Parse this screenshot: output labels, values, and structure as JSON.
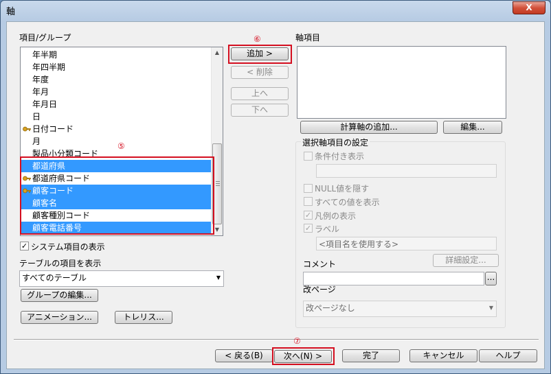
{
  "window": {
    "title": "軸",
    "close_label": "X"
  },
  "left": {
    "items_label": "項目/グループ",
    "list_items": [
      {
        "label": "年半期",
        "key": false,
        "selected": false
      },
      {
        "label": "年四半期",
        "key": false,
        "selected": false
      },
      {
        "label": "年度",
        "key": false,
        "selected": false
      },
      {
        "label": "年月",
        "key": false,
        "selected": false
      },
      {
        "label": "年月日",
        "key": false,
        "selected": false
      },
      {
        "label": "日",
        "key": false,
        "selected": false
      },
      {
        "label": "日付コード",
        "key": true,
        "selected": false
      },
      {
        "label": "月",
        "key": false,
        "selected": false
      },
      {
        "label": "製品小分類コード",
        "key": false,
        "selected": false
      },
      {
        "label": "都道府県",
        "key": false,
        "selected": true
      },
      {
        "label": "都道府県コード",
        "key": true,
        "selected": false
      },
      {
        "label": "顧客コード",
        "key": true,
        "selected": true
      },
      {
        "label": "顧客名",
        "key": false,
        "selected": true
      },
      {
        "label": "顧客種別コード",
        "key": false,
        "selected": false
      },
      {
        "label": "顧客電話番号",
        "key": false,
        "selected": true
      }
    ],
    "show_system_items": {
      "label": "システム項目の表示",
      "checked": true
    },
    "table_items_label": "テーブルの項目を表示",
    "table_select_value": "すべてのテーブル",
    "edit_group_button": "グループの編集...",
    "animation_button": "アニメーション...",
    "trellis_button": "トレリス..."
  },
  "middle": {
    "add_button": "追加 >",
    "delete_button": "< 削除",
    "up_button": "上へ",
    "down_button": "下へ"
  },
  "right": {
    "axis_items_label": "軸項目",
    "add_calc_axis_button": "計算軸の追加...",
    "edit_button": "編集...",
    "settings_group_label": "選択軸項目の設定",
    "conditional_display": {
      "label": "条件付き表示",
      "checked": false
    },
    "hide_null": {
      "label": "NULL値を隠す",
      "checked": false
    },
    "show_all_values": {
      "label": "すべての値を表示",
      "checked": false
    },
    "show_legend": {
      "label": "凡例の表示",
      "checked": true
    },
    "label_check": {
      "label": "ラベル",
      "checked": true
    },
    "label_placeholder": "<項目名を使用する>",
    "detail_settings_button": "詳細設定...",
    "comment_label": "コメント",
    "comment_browse": "...",
    "page_break_label": "改ページ",
    "page_break_value": "改ページなし"
  },
  "footer": {
    "back_button": "< 戻る(B)",
    "next_button": "次へ(N) >",
    "finish_button": "完了",
    "cancel_button": "キャンセル",
    "help_button": "ヘルプ"
  },
  "annotations": {
    "n5": "⑤",
    "n6": "⑥",
    "n7": "⑦"
  },
  "colors": {
    "highlight": "#d40e1f",
    "selection": "#3399ff"
  }
}
